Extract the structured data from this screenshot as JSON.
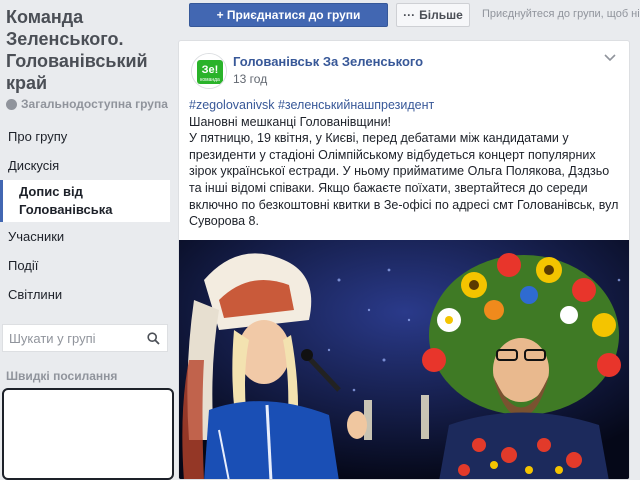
{
  "group": {
    "title": "Команда Зеленського. Голованівський край",
    "privacy": "Загальнодоступна група"
  },
  "nav": {
    "items": [
      "Про групу",
      "Дискусія",
      "Допис від Голованівська",
      "Учасники",
      "Події",
      "Світлини"
    ]
  },
  "search": {
    "placeholder": "Шукати у групі"
  },
  "quick_links": {
    "label": "Швидкі посилання"
  },
  "topbar": {
    "join_label": "+ Приєднатися до групи",
    "more_label": "Більше",
    "join_hint": "Приєднуйтеся до групи, щоб ні"
  },
  "post": {
    "page_name": "Голованівськ За Зеленського",
    "time": "13 год",
    "hashtags": "#zegolovanivsk #зеленськийнашпрезидент",
    "body_lines": [
      "Шановні мешканці Голованівщини!",
      "У пятницю, 19 квітня, у Києві, перед дебатами між кандидатами у президенти у стадіоні Олімпійському відбудеться концерт популярних зірок української естради. У ньому прийматиме Ольга Полякова, Дздзьо та інші відомі співаки. Якщо бажаєте поїхати, звертайтеся до середи включно по безкоштовні квитки в Зе-офісі по адресі смт Голованівськ, вул Суворова 8."
    ],
    "avatar_text": "Зе!",
    "avatar_subtext": "команда"
  },
  "colors": {
    "accent": "#4267b2",
    "link": "#385898",
    "avatar_green": "#2ab32a"
  },
  "icons": [
    "globe-icon",
    "search-icon",
    "chevron-down-icon"
  ]
}
